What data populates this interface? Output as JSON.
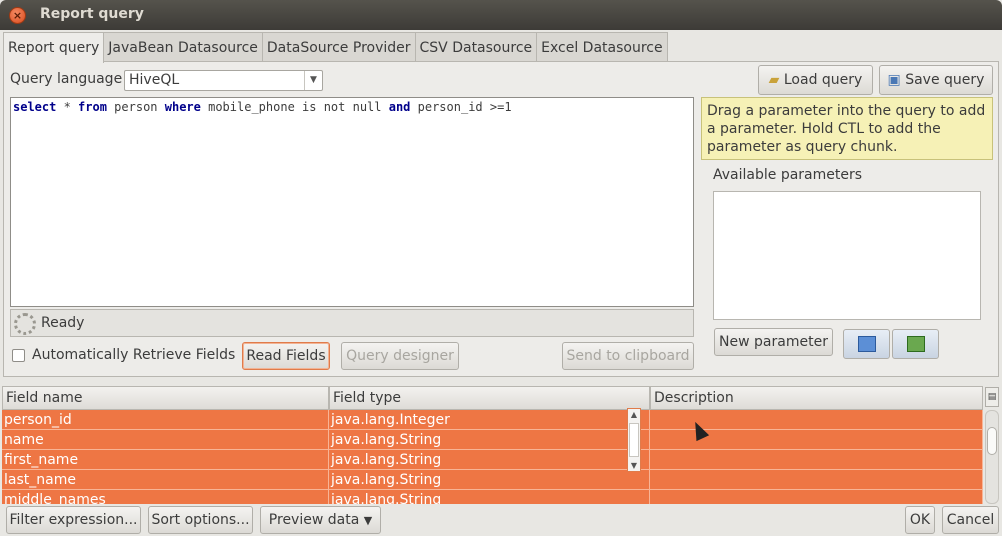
{
  "window": {
    "title": "Report query"
  },
  "tabs": [
    {
      "label": "Report query"
    },
    {
      "label": "JavaBean Datasource"
    },
    {
      "label": "DataSource Provider"
    },
    {
      "label": "CSV Datasource"
    },
    {
      "label": "Excel Datasource"
    }
  ],
  "query": {
    "language_label": "Query language",
    "language_value": "HiveQL",
    "text_parts": [
      "select",
      " * ",
      "from",
      " person ",
      "where",
      " mobile_phone is not null ",
      "and",
      " person_id >=1"
    ],
    "status": "Ready",
    "auto_retrieve_label": "Automatically Retrieve Fields",
    "read_fields": "Read Fields",
    "query_designer": "Query designer",
    "send_to_clipboard": "Send to clipboard"
  },
  "side": {
    "load_query": "Load query",
    "save_query": "Save query",
    "hint": "Drag a parameter into the query to add a parameter. Hold CTL to add the parameter as query chunk.",
    "available_parameters": "Available parameters",
    "new_parameter": "New parameter"
  },
  "fields_table": {
    "headers": [
      "Field name",
      "Field type",
      "Description"
    ],
    "rows": [
      [
        "person_id",
        "java.lang.Integer",
        ""
      ],
      [
        "name",
        "java.lang.String",
        ""
      ],
      [
        "first_name",
        "java.lang.String",
        ""
      ],
      [
        "last_name",
        "java.lang.String",
        ""
      ],
      [
        "middle_names",
        "java.lang.String",
        ""
      ]
    ]
  },
  "footer": {
    "filter": "Filter expression...",
    "sort": "Sort options...",
    "preview": "Preview data",
    "ok": "OK",
    "cancel": "Cancel"
  },
  "colors": {
    "selection": "#ee7644",
    "hint_bg": "#f6f1b6",
    "title_bg": "#3d3b37"
  }
}
